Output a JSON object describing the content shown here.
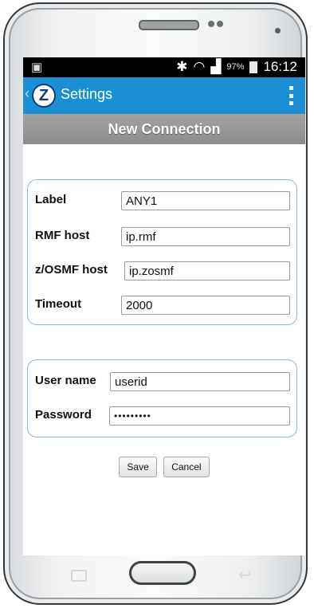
{
  "status_bar": {
    "signal_percent": "97%",
    "time": "16:12"
  },
  "app_bar": {
    "logo_letter": "Z",
    "title": "Settings"
  },
  "page": {
    "title": "New Connection"
  },
  "connection": {
    "label_label": "Label",
    "label_value": "ANY1",
    "rmf_label": "RMF host",
    "rmf_value": "ip.rmf",
    "zosmf_label": "z/OSMF host",
    "zosmf_value": "ip.zosmf",
    "timeout_label": "Timeout",
    "timeout_value": "2000"
  },
  "credentials": {
    "username_label": "User name",
    "username_value": "userid",
    "password_label": "Password",
    "password_value": "•••••••••"
  },
  "actions": {
    "save_label": "Save",
    "cancel_label": "Cancel"
  },
  "colors": {
    "app_bar": "#1b8fd3",
    "title_bar": "#999999",
    "group_border": "#8fb9d8"
  }
}
